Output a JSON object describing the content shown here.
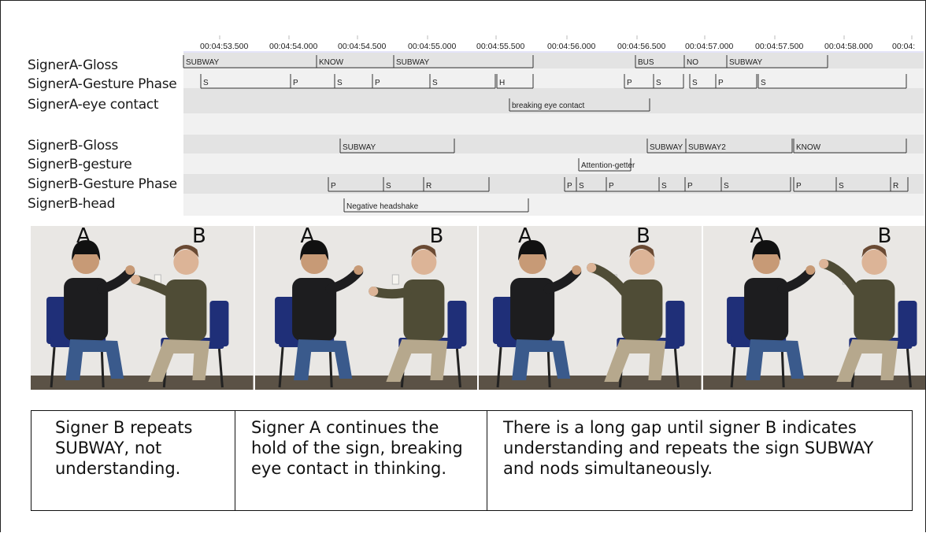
{
  "time_ticks": [
    "00:04:53.500",
    "00:04:54.000",
    "00:04:54.500",
    "00:04:55.000",
    "00:04:55.500",
    "00:04:56.000",
    "00:04:56.500",
    "00:04:57.000",
    "00:04:57.500",
    "00:04:58.000",
    "00:04:"
  ],
  "tiers": [
    {
      "name": "SignerA-Gloss"
    },
    {
      "name": "SignerA-Gesture Phase"
    },
    {
      "name": "SignerA-eye contact"
    },
    {
      "name": ""
    },
    {
      "name": "SignerB-Gloss"
    },
    {
      "name": "SignerB-gesture"
    },
    {
      "name": "SignerB-Gesture Phase"
    },
    {
      "name": "SignerB-head"
    }
  ],
  "annotations": {
    "signerA_gloss": [
      "SUBWAY",
      "KNOW",
      "SUBWAY",
      "BUS",
      "NO",
      "SUBWAY"
    ],
    "signerA_phase": [
      "S",
      "P",
      "S",
      "P",
      "S",
      "H",
      "P",
      "S",
      "S",
      "P",
      "S"
    ],
    "signerA_eye": [
      "breaking eye contact"
    ],
    "signerB_gloss": [
      "SUBWAY",
      "SUBWAY",
      "SUBWAY2",
      "KNOW"
    ],
    "signerB_gesture": [
      "Attention-getter"
    ],
    "signerB_phase": [
      "P",
      "S",
      "R",
      "P",
      "S",
      "P",
      "S",
      "P",
      "S",
      "P",
      "S",
      "R"
    ],
    "signerB_head": [
      "Negative headshake"
    ]
  },
  "panels": [
    {
      "left_label": "A",
      "right_label": "B"
    },
    {
      "left_label": "A",
      "right_label": "B"
    },
    {
      "left_label": "A",
      "right_label": "B"
    },
    {
      "left_label": "A",
      "right_label": "B"
    }
  ],
  "captions": [
    "Signer B repeats SUBWAY, not understanding.",
    "Signer A continues the hold of the sign, breaking eye contact in thinking.",
    "There is a long gap until signer B indicates understanding and repeats the sign SUBWAY and nods simultaneously."
  ],
  "colors": {
    "tier_bg_dark": "#e3e3e3",
    "tier_bg_light": "#f1f1f1",
    "bracket": "#333333",
    "tick_rule": "#c9c9f0",
    "shirt_a": "#1d1d1f",
    "jeans_a": "#3a5a8c",
    "shirt_b": "#4f4c36",
    "pants_b": "#b6a88d",
    "chair": "#1f2f78",
    "wall": "#e9e7e4"
  }
}
